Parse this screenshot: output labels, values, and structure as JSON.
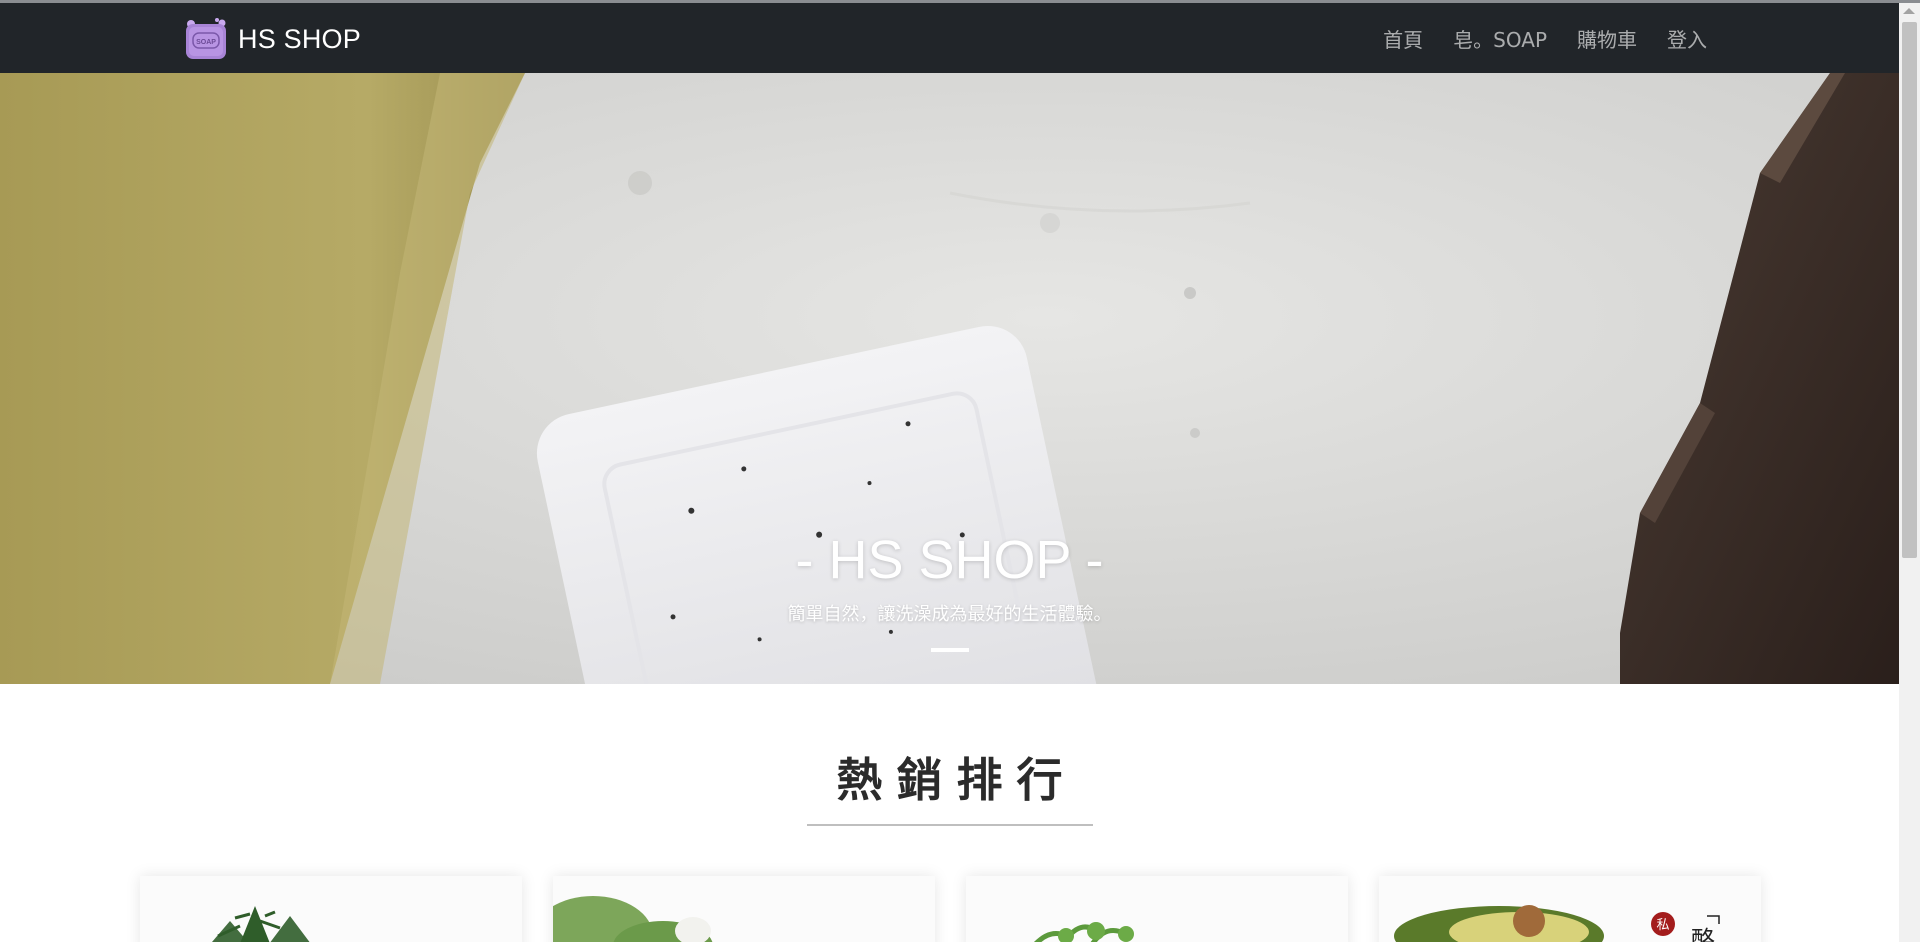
{
  "navbar": {
    "brand_text": "HS SHOP",
    "logo_text": "SOAP",
    "links": [
      {
        "label": "首頁"
      },
      {
        "label": "皂。SOAP"
      },
      {
        "label": "購物車"
      },
      {
        "label": "登入"
      }
    ]
  },
  "hero": {
    "title": "- HS SHOP -",
    "subtitle": "簡單自然，讓洗澡成為最好的生活體驗。"
  },
  "section": {
    "title": "熱銷排行"
  },
  "cards": [
    {
      "name": "product-card-1"
    },
    {
      "name": "product-card-2"
    },
    {
      "name": "product-card-3"
    },
    {
      "name": "product-card-4",
      "stamp_text": "私",
      "vertical_text": "酪"
    }
  ],
  "colors": {
    "navbar_bg": "#212529",
    "logo_purple": "#b48fe0"
  }
}
